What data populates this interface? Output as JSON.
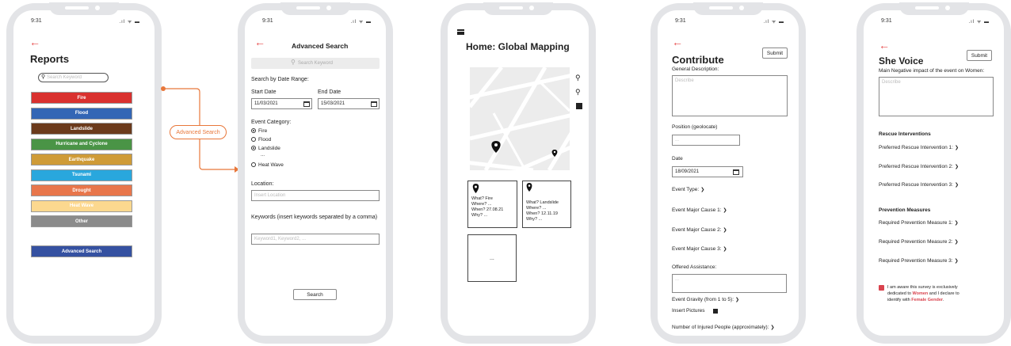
{
  "status": {
    "time": "9:31",
    "signal": ".ıl ᯤ ▬"
  },
  "reports": {
    "title": "Reports",
    "search_placeholder": "Search Keyword",
    "categories": [
      {
        "label": "Fire",
        "color": "#d9312f"
      },
      {
        "label": "Flood",
        "color": "#3366b5"
      },
      {
        "label": "Landslide",
        "color": "#6b3a1c"
      },
      {
        "label": "Hurricane and Cyclone",
        "color": "#4a9446"
      },
      {
        "label": "Earthquake",
        "color": "#cf9b37"
      },
      {
        "label": "Tsunami",
        "color": "#29a7dd"
      },
      {
        "label": "Drought",
        "color": "#e8764b"
      },
      {
        "label": "Heat Wave",
        "color": "#fcd88f"
      },
      {
        "label": "Other",
        "color": "#8b8b8b"
      }
    ],
    "advanced_button": "Advanced Search",
    "advanced_color": "#3551a1"
  },
  "flow": {
    "label": "Advanced Search",
    "color": "#e8773a"
  },
  "advanced": {
    "title": "Advanced Search",
    "search_placeholder": "Search Keyword",
    "date_range_label": "Search by Date Range:",
    "start_label": "Start Date",
    "end_label": "End Date",
    "start_value": "11/03/2021",
    "end_value": "15/03/2021",
    "category_label": "Event Category:",
    "options": [
      "Fire",
      "Flood",
      "Landslide",
      "...",
      "Heat Wave"
    ],
    "location_label": "Location:",
    "location_placeholder": "Insert Location",
    "keywords_label": "Keywords (insert keywords separated by a comma)",
    "keywords_placeholder": "Keyword1, Keyword2, ...",
    "search_button": "Search"
  },
  "home": {
    "title": "Home: Global Mapping",
    "cards": [
      {
        "what": "What? Fire",
        "where": "Where? ...",
        "when": "When? 27.08.21",
        "why": "Why? ..."
      },
      {
        "what": "What? Landslide",
        "where": "Where? ...",
        "when": "When? 12.11.19",
        "why": "Why? ..."
      }
    ],
    "empty_card": "..."
  },
  "contribute": {
    "title": "Contribute",
    "submit": "Submit",
    "general_label": "General Description:",
    "describe_placeholder": "Describe",
    "position_label": "Position (geolocate)",
    "position_placeholder": "...",
    "date_label": "Date",
    "date_value": "18/09/2021",
    "event_type": "Event Type:",
    "cause1": "Event Major Cause 1:",
    "cause2": "Event Major Cause 2:",
    "cause3": "Event Major Cause 3:",
    "assistance_label": "Offered Assistance:",
    "assistance_placeholder": "...",
    "gravity": "Event Gravity (from 1 to 5):",
    "pictures": "Insert Pictures",
    "injured": "Number of Injured People (approximately):"
  },
  "shevoice": {
    "title": "She Voice",
    "submit": "Submit",
    "impact_label": "Main Negative impact of the event on Women:",
    "describe_placeholder": "Describe",
    "rescue_header": "Rescue Interventions",
    "rescue": [
      "Preferred Rescue Intervention 1:",
      "Preferred Rescue Intervention 2:",
      "Preferred Rescue Intervention 3:"
    ],
    "prevention_header": "Prevention Measures",
    "prevention": [
      "Required Prevention Measure 1:",
      "Required Prevention Measure 2:",
      "Required Prevention Measure 3:"
    ],
    "consent_1": "I am aware this survey is exclusively",
    "consent_2a": "dedicated to",
    "consent_2b": "Women",
    "consent_2c": "and I declare to",
    "consent_3a": "identify with",
    "consent_3b": "Female Gender",
    "consent_3c": "."
  }
}
